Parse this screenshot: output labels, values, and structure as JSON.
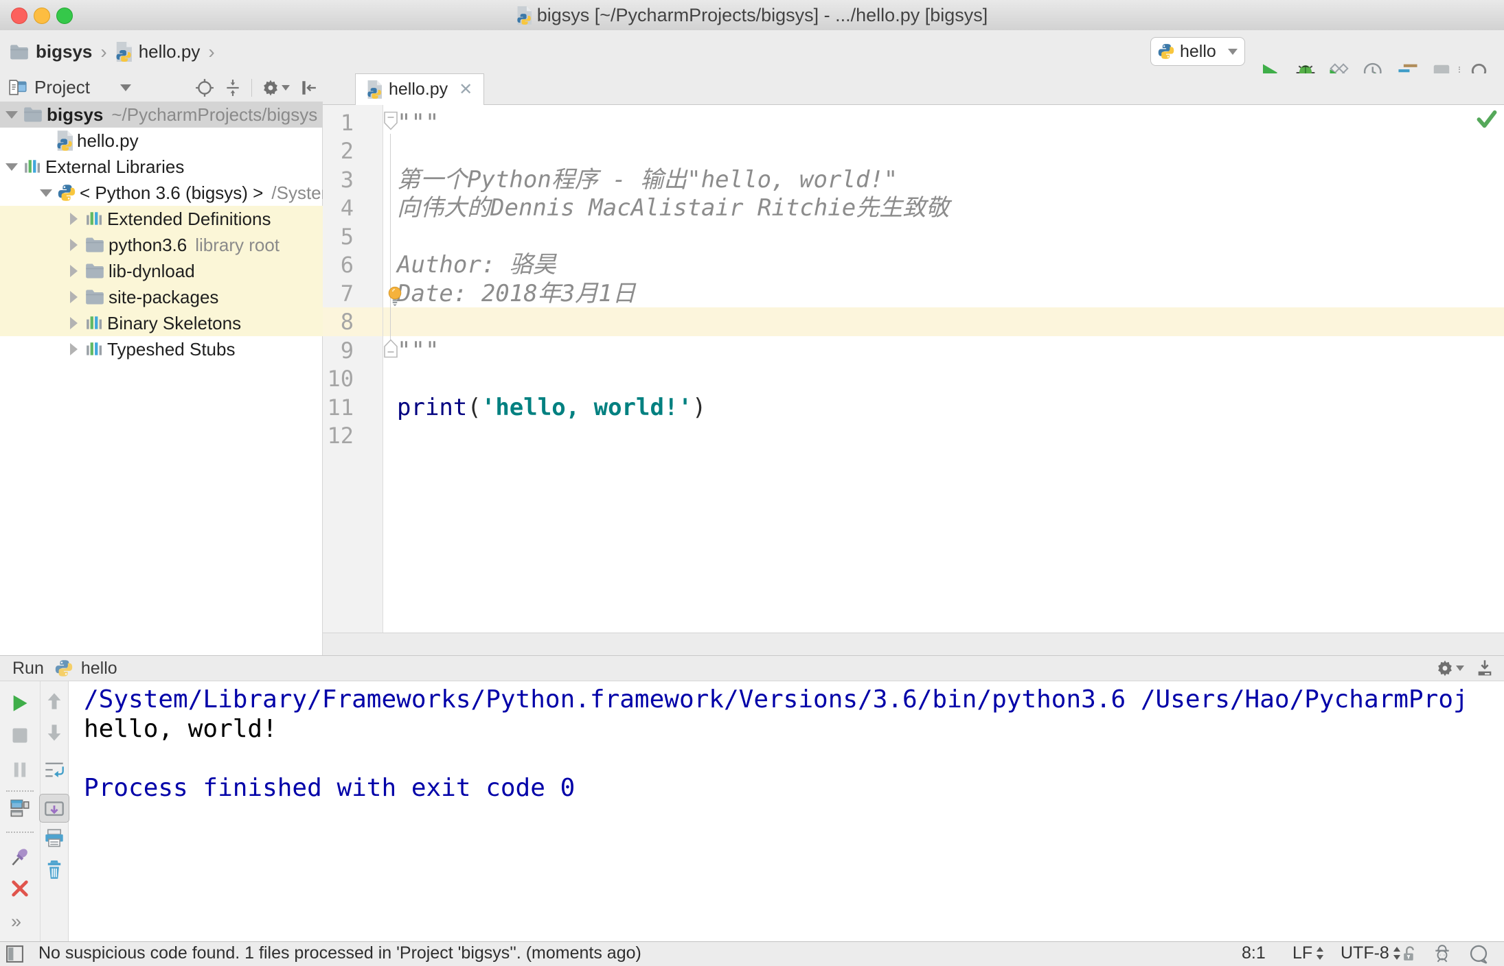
{
  "title_bar": {
    "title": "bigsys [~/PycharmProjects/bigsys] - .../hello.py [bigsys]"
  },
  "icons": {
    "breadcrumb_separator": "›",
    "tab_close": "✕",
    "more_chevrons": "»"
  },
  "toolbar": {
    "breadcrumb": {
      "project": "bigsys",
      "file": "hello.py"
    },
    "run_config": {
      "label": "hello"
    }
  },
  "project_panel": {
    "title": "Project",
    "tree": [
      {
        "label": "bigsys",
        "detail": "~/PycharmProjects/bigsys"
      },
      {
        "label": "hello.py"
      },
      {
        "label": "External Libraries"
      },
      {
        "label": "< Python 3.6 (bigsys) >",
        "detail": "/System"
      },
      {
        "label": "Extended Definitions"
      },
      {
        "label": "python3.6",
        "detail": "library root"
      },
      {
        "label": "lib-dynload"
      },
      {
        "label": "site-packages"
      },
      {
        "label": "Binary Skeletons"
      },
      {
        "label": "Typeshed Stubs"
      }
    ]
  },
  "editor": {
    "tab": {
      "label": "hello.py"
    },
    "line_numbers": [
      "1",
      "2",
      "3",
      "4",
      "5",
      "6",
      "7",
      "8",
      "9",
      "10",
      "11",
      "12"
    ],
    "code": {
      "line1": "\"\"\"",
      "line3": "第一个Python程序 - 输出\"hello, world!\"",
      "line4": "向伟大的Dennis MacAlistair Ritchie先生致敬",
      "line6": "Author: 骆昊",
      "line7": "Date: 2018年3月1日",
      "line9": "\"\"\"",
      "line11": {
        "keyword": "print",
        "open": "(",
        "string": "'hello, world!'",
        "close": ")"
      }
    }
  },
  "run_panel": {
    "title": "Run",
    "config": "hello",
    "console": {
      "line1": "/System/Library/Frameworks/Python.framework/Versions/3.6/bin/python3.6 /Users/Hao/PycharmProj",
      "line2": "hello, world!",
      "line4": "Process finished with exit code 0"
    }
  },
  "status_bar": {
    "message": "No suspicious code found. 1 files processed in 'Project 'bigsys''. (moments ago)",
    "caret_position": "8:1",
    "line_separator": "LF",
    "encoding": "UTF-8"
  },
  "colors": {
    "accent_green": "#3fae49",
    "selection_gray": "#d4d4d4",
    "library_highlight": "#fbf6d7",
    "caret_line": "#fcf5dc",
    "keyword_blue": "#000080",
    "string_teal": "#008080",
    "console_system_blue": "#0000a8"
  }
}
